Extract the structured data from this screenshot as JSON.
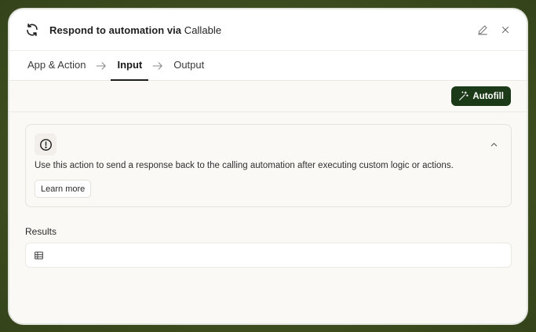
{
  "header": {
    "title_prefix": "Respond to automation via ",
    "title_app": "Callable",
    "icons": {
      "sync": "sync-icon",
      "edit": "pencil-icon",
      "close": "close-icon"
    }
  },
  "tabs": [
    {
      "label": "App & Action",
      "active": false
    },
    {
      "label": "Input",
      "active": true
    },
    {
      "label": "Output",
      "active": false
    }
  ],
  "toolbar": {
    "autofill_label": "Autofill",
    "autofill_color": "#1c3a17"
  },
  "info_card": {
    "description": "Use this action to send a response back to the calling automation after executing custom logic or actions.",
    "learn_more_label": "Learn more"
  },
  "results": {
    "label": "Results",
    "icon": "table-icon"
  }
}
